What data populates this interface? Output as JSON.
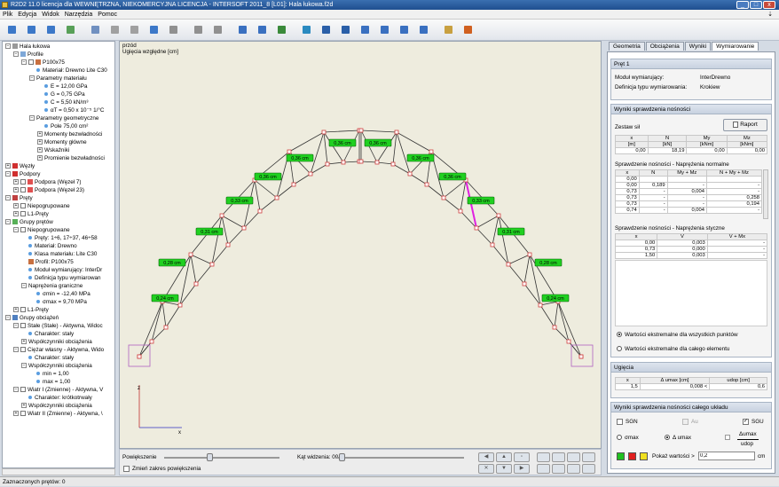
{
  "window": {
    "title": "R2D2 11.0 licencja dla WEWNĘTRZNA, NIEKOMERCYJNA LICENCJA - INTERSOFT 2011_8 [L01]: Hala łukowa.f2d"
  },
  "menu": [
    "Plik",
    "Edycja",
    "Widok",
    "Narzędzia",
    "Pomoc"
  ],
  "tree": [
    {
      "t": "Hala łukowa",
      "lv": 0,
      "ex": "-",
      "ic": "#999"
    },
    {
      "t": "Profile",
      "lv": 1,
      "ex": "-",
      "ic": "#7ea8d8"
    },
    {
      "t": "P100x75",
      "lv": 2,
      "ex": "-",
      "ic": "#c87040",
      "cb": true
    },
    {
      "t": "Materiał: Drewno Lite C30",
      "lv": 3,
      "dot": true
    },
    {
      "t": "Parametry materiału",
      "lv": 3,
      "ex": "-"
    },
    {
      "t": "E = 12,00 GPa",
      "lv": 4,
      "dot": true
    },
    {
      "t": "G = 0,75 GPa",
      "lv": 4,
      "dot": true
    },
    {
      "t": "C = 5,50 kN/m³",
      "lv": 4,
      "dot": true
    },
    {
      "t": "αT = 0,50 x 10⁻⁵ 1/°C",
      "lv": 4,
      "dot": true
    },
    {
      "t": "Parametry geometryczne",
      "lv": 3,
      "ex": "-"
    },
    {
      "t": "Pole 75,00 cm²",
      "lv": 4,
      "dot": true
    },
    {
      "t": "Momenty bezwładności",
      "lv": 4,
      "ex": "+"
    },
    {
      "t": "Momenty główne",
      "lv": 4,
      "ex": "+"
    },
    {
      "t": "Wskaźniki",
      "lv": 4,
      "ex": "+"
    },
    {
      "t": "Promienie bezwładności",
      "lv": 4,
      "ex": "+"
    },
    {
      "t": "Węzły",
      "lv": 0,
      "ex": "+",
      "ic": "#d03030"
    },
    {
      "t": "Podpory",
      "lv": 0,
      "ex": "-",
      "ic": "#d03030"
    },
    {
      "t": "Podpora (Węzeł 7)",
      "lv": 1,
      "ex": "+",
      "ic": "#e05050",
      "cb": true
    },
    {
      "t": "Podpora (Węzeł 23)",
      "lv": 1,
      "ex": "+",
      "ic": "#e05050",
      "cb": true
    },
    {
      "t": "Pręty",
      "lv": 0,
      "ex": "-",
      "ic": "#c04040"
    },
    {
      "t": "Niepogrupowane",
      "lv": 1,
      "ex": "+",
      "cb": true
    },
    {
      "t": "L1-Pręty",
      "lv": 1,
      "ex": "+",
      "cb": true
    },
    {
      "t": "Grupy prętów",
      "lv": 0,
      "ex": "-",
      "ic": "#58b058"
    },
    {
      "t": "Niepogrupowane",
      "lv": 1,
      "ex": "-",
      "cb": true
    },
    {
      "t": "Pręty: 1÷6, 17÷37, 46÷58",
      "lv": 2,
      "dot": true
    },
    {
      "t": "Materiał: Drewno",
      "lv": 2,
      "dot": true
    },
    {
      "t": "Klasa materiału: Lite C30",
      "lv": 2,
      "dot": true
    },
    {
      "t": "Profil: P100x75",
      "lv": 2,
      "ic": "#c87040"
    },
    {
      "t": "Moduł wymiarujący: InterDr",
      "lv": 2,
      "dot": true
    },
    {
      "t": "Definicja typu wymiarowan",
      "lv": 2,
      "dot": true
    },
    {
      "t": "Naprężenia graniczne",
      "lv": 2,
      "ex": "-"
    },
    {
      "t": "σmin = -12,40 MPa",
      "lv": 3,
      "dot": true
    },
    {
      "t": "σmax = 9,70 MPa",
      "lv": 3,
      "dot": true
    },
    {
      "t": "L1-Pręty",
      "lv": 1,
      "ex": "+",
      "cb": true
    },
    {
      "t": "Grupy obciążeń",
      "lv": 0,
      "ex": "-",
      "ic": "#5080c0"
    },
    {
      "t": "Stałe (Stałe) - Aktywna, Widoc",
      "lv": 1,
      "ex": "-",
      "cb": true
    },
    {
      "t": "Charakter: stały",
      "lv": 2,
      "dot": true
    },
    {
      "t": "Współczynniki obciążenia",
      "lv": 2,
      "ex": "+"
    },
    {
      "t": "Ciężar własny - Aktywna, Wido",
      "lv": 1,
      "ex": "-",
      "cb": true
    },
    {
      "t": "Charakter: stały",
      "lv": 2,
      "dot": true
    },
    {
      "t": "Współczynniki obciążenia",
      "lv": 2,
      "ex": "-"
    },
    {
      "t": "min = 1,00",
      "lv": 3,
      "dot": true
    },
    {
      "t": "max = 1,00",
      "lv": 3,
      "dot": true
    },
    {
      "t": "Wiatr I (Zmienne) - Aktywna, V",
      "lv": 1,
      "ex": "-",
      "cb": true
    },
    {
      "t": "Charakter: krótkotrwały",
      "lv": 2,
      "dot": true
    },
    {
      "t": "Współczynniki obciążenia",
      "lv": 2,
      "ex": "+"
    },
    {
      "t": "Wiatr II (Zmienne) - Aktywna, \\",
      "lv": 1,
      "ex": "+",
      "cb": true
    }
  ],
  "canvas": {
    "view": "przód",
    "subtitle": "Ugięcia względne [cm]",
    "labels": [
      "0,24 cm",
      "0,28 cm",
      "0,31 cm",
      "0,33 cm",
      "0,36 cm",
      "0,36 cm",
      "0,36 cm",
      "0,36 cm",
      "0,36 cm",
      "0,36 cm",
      "0,33 cm",
      "0,31 cm",
      "0,28 cm",
      "0,24 cm"
    ],
    "axis_x": "x",
    "axis_z": "z"
  },
  "bottombar": {
    "zoom_label": "Powiększenie",
    "angle_label": "Kąt widzenia: 00",
    "zoom_range_label": "Zmień zakres powiększenia"
  },
  "status": "Zaznaczonych prętów: 0",
  "tabs": [
    "Geometria",
    "Obciążenia",
    "Wyniki",
    "Wymiarowanie"
  ],
  "bar_panel": {
    "title": "Pręt 1",
    "module_label": "Moduł wymiarujący:",
    "module_value": "InterDrewno",
    "def_label": "Definicja typu wymiarowania:",
    "def_value": "Krokiew"
  },
  "results": {
    "title": "Wyniki sprawdzenia nośności",
    "zestaw": "Zestaw sił",
    "raport": "Raport",
    "forces_head": [
      [
        "x",
        "N",
        "My",
        "Mz"
      ],
      [
        "[m]",
        "[kN]",
        "[kNm]",
        "[kNm]"
      ]
    ],
    "forces_row": [
      "0,00",
      "18,19",
      "0,00",
      "0,00"
    ],
    "normal_title": "Sprawdzenie nośności - Naprężenia normalne",
    "normal_head": [
      "x",
      "N",
      "My + Mz",
      "N + My + Mz"
    ],
    "normal_rows": [
      [
        "0,00",
        "",
        "",
        ""
      ],
      [
        "0,00",
        "0,189",
        "-",
        "-"
      ],
      [
        "0,73",
        "-",
        "0,004",
        "-"
      ],
      [
        "0,73",
        "-",
        "-",
        "0,258"
      ],
      [
        "0,73",
        "-",
        "-",
        "0,194"
      ],
      [
        "0,74",
        "-",
        "0,004",
        "-"
      ]
    ],
    "shear_title": "Sprawdzenie nośności - Naprężenia styczne",
    "shear_head": [
      "x",
      "V",
      "V + Mx"
    ],
    "shear_rows": [
      [
        "0,00",
        "0,003",
        "-"
      ],
      [
        "0,73",
        "0,000",
        "-"
      ],
      [
        "1,50",
        "0,003",
        "-"
      ]
    ],
    "radio1": "Wartości ekstremalne dla wszystkich punktów",
    "radio2": "Wartości ekstremalne dla całego elementu"
  },
  "deflection": {
    "title": "Ugięcia",
    "head": [
      "x",
      "Δ umax [cm]",
      "udop [cm]"
    ],
    "row": [
      "1,5",
      "0,008 <",
      "0,6"
    ]
  },
  "system": {
    "title": "Wyniki sprawdzenia nośności całego układu",
    "sgn": "SGN",
    "au": "Au",
    "sgu": "SGU",
    "sigma": "σmax",
    "delta": "Δ umax",
    "ratio_top": "Δumax",
    "ratio_bot": "udop",
    "show_label": "Pokaż wartości >",
    "show_value": "0,2",
    "unit": "cm"
  },
  "colors": {
    "accent": "#2a5fa8",
    "label_bg": "#20d020",
    "highlight": "#e020e0"
  }
}
